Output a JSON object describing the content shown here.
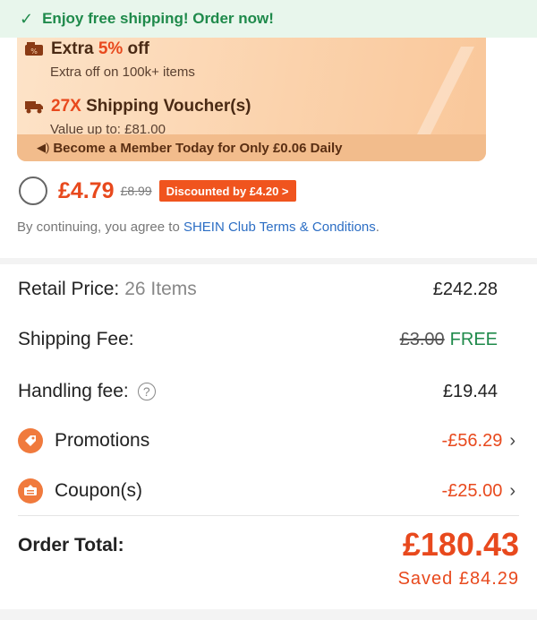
{
  "shipping_banner": {
    "text": "Enjoy free shipping! Order now!",
    "icon": "check-icon"
  },
  "club_card": {
    "benefits": [
      {
        "icon": "percent-tag-icon",
        "highlight_prefix": "Extra ",
        "highlight": "5%",
        "suffix": " off",
        "sub": "Extra off on 100k+ items"
      },
      {
        "icon": "truck-icon",
        "highlight": "27X",
        "suffix": " Shipping Voucher(s)",
        "sub": "Value up to: £81.00"
      }
    ],
    "member_bar_text": "Become a Member Today for Only £0.06 Daily",
    "price_now": "£4.79",
    "price_old": "£8.99",
    "discount_badge": "Discounted by £4.20 >",
    "terms_prefix": "By continuing, you agree to ",
    "terms_link": "SHEIN Club Terms & Conditions",
    "terms_suffix": "."
  },
  "summary": {
    "retail_label": "Retail Price:",
    "retail_items": "26 Items",
    "retail_value": "£242.28",
    "shipping_label": "Shipping Fee:",
    "shipping_old": "£3.00",
    "shipping_value": "FREE",
    "handling_label": "Handling fee:",
    "handling_value": "£19.44",
    "promotions_label": "Promotions",
    "promotions_value": "-£56.29",
    "coupons_label": "Coupon(s)",
    "coupons_value": "-£25.00",
    "total_label": "Order Total:",
    "total_value": "£180.43",
    "saved": "Saved £84.29"
  },
  "colors": {
    "accent": "#e8491d",
    "green": "#1f8a4b",
    "link": "#2c6ec4"
  }
}
